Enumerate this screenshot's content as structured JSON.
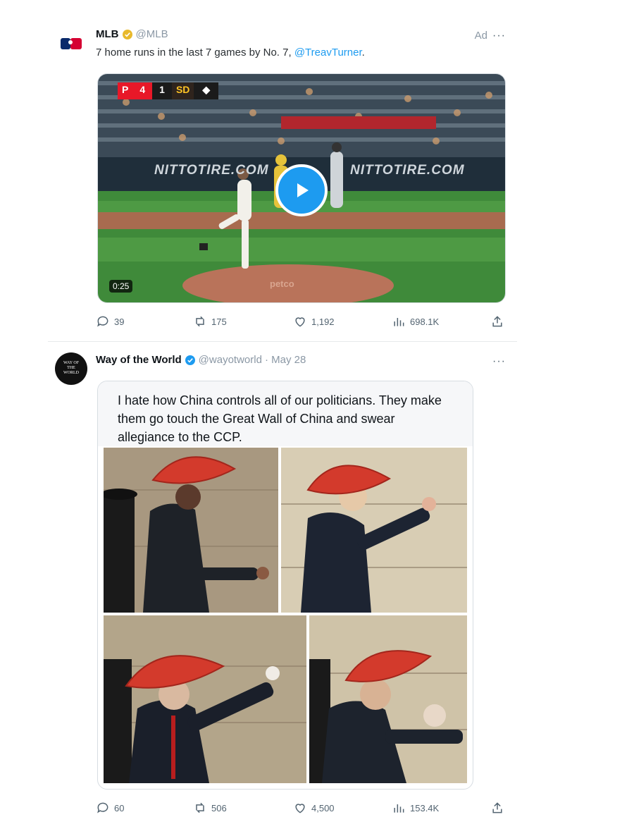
{
  "tweets": [
    {
      "name": "MLB",
      "handle": "@MLB",
      "ad_label": "Ad",
      "more": "···",
      "text": "7 home runs in the last 7 games by No. 7, ",
      "mention": "@TreavTurner",
      "text_end": ".",
      "video": {
        "duration": "0:25",
        "scoreboard": {
          "home_logo": "P",
          "home_score": "4",
          "away_score": "1"
        },
        "banner_left": "NITTOTIRE.COM",
        "banner_right": "NITTOTIRE.COM",
        "mound_text": "petco"
      },
      "stats": {
        "replies": "39",
        "reposts": "175",
        "likes": "1,192",
        "views": "698.1K"
      }
    },
    {
      "name": "Way of the World",
      "handle": "@wayotworld",
      "date": "· May 28",
      "more": "···",
      "avatar_text": "WAY OF THE WORLD",
      "quote_text": "I hate how China controls all of our politicians. They make them go touch the Great Wall of China and swear allegiance to the CCP.",
      "stats": {
        "replies": "60",
        "reposts": "506",
        "likes": "4,500",
        "views": "153.4K"
      }
    }
  ],
  "colors": {
    "accent": "#1d9bf0",
    "muted": "#536471",
    "divider": "#e7e9eb",
    "hat_red": "#d33a2c"
  }
}
